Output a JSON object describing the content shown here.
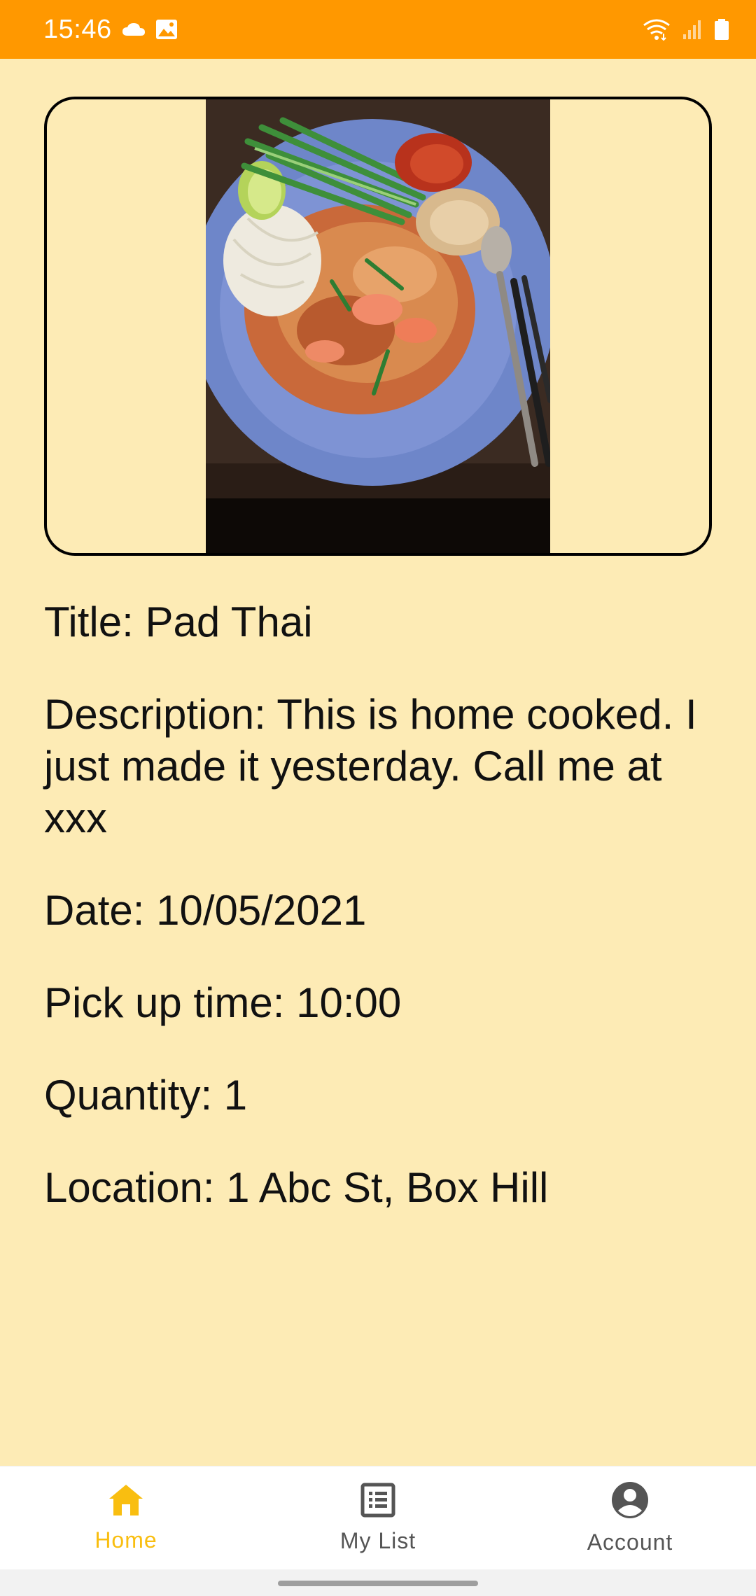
{
  "status_bar": {
    "time": "15:46",
    "background": "#FF9800",
    "left_icons": [
      "cloud-icon",
      "image-icon"
    ],
    "right_icons": [
      "wifi-icon",
      "signal-icon",
      "battery-icon"
    ]
  },
  "listing": {
    "image": {
      "subject": "pad-thai-photo"
    },
    "title_line": "Title: Pad Thai",
    "description_line": "Description: This is home cooked. I just made it yesterday. Call me at xxx",
    "date_line": "Date: 10/05/2021",
    "pickup_line": "Pick up time: 10:00",
    "quantity_line": "Quantity: 1",
    "location_line": "Location: 1 Abc St, Box Hill"
  },
  "bottom_nav": {
    "items": [
      {
        "label": "Home",
        "icon": "home-icon",
        "active": true
      },
      {
        "label": "My List",
        "icon": "list-icon",
        "active": false
      },
      {
        "label": "Account",
        "icon": "account-icon",
        "active": false
      }
    ]
  },
  "colors": {
    "page_background": "#FDEBB5",
    "accent": "#FF9800",
    "nav_active": "#F9BE10",
    "nav_inactive": "#555555"
  }
}
